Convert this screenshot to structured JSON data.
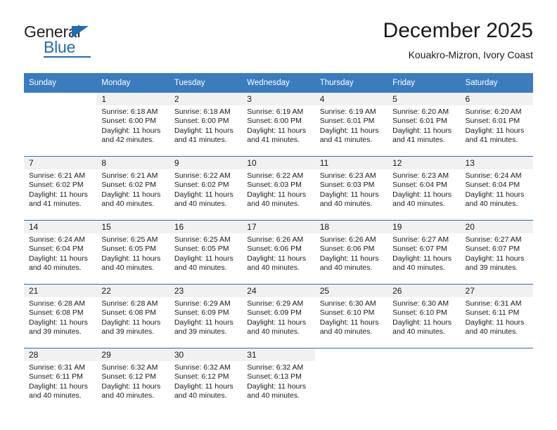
{
  "logo": {
    "word_top": "General",
    "word_bottom": "Blue",
    "triangle_color": "#1f6cb0"
  },
  "header": {
    "title": "December 2025",
    "subtitle": "Kouakro-Mizron, Ivory Coast"
  },
  "theme": {
    "header_row_bg": "#3a7cbe",
    "day_band_bg": "#f1f1f1",
    "row_divider": "#2f6fa8",
    "text": "#1a1a1a"
  },
  "weekday_headers": [
    "Sunday",
    "Monday",
    "Tuesday",
    "Wednesday",
    "Thursday",
    "Friday",
    "Saturday"
  ],
  "weeks": [
    [
      {
        "day": "",
        "lines": []
      },
      {
        "day": "1",
        "lines": [
          "Sunrise: 6:18 AM",
          "Sunset: 6:00 PM",
          "Daylight: 11 hours",
          "and 42 minutes."
        ]
      },
      {
        "day": "2",
        "lines": [
          "Sunrise: 6:18 AM",
          "Sunset: 6:00 PM",
          "Daylight: 11 hours",
          "and 41 minutes."
        ]
      },
      {
        "day": "3",
        "lines": [
          "Sunrise: 6:19 AM",
          "Sunset: 6:00 PM",
          "Daylight: 11 hours",
          "and 41 minutes."
        ]
      },
      {
        "day": "4",
        "lines": [
          "Sunrise: 6:19 AM",
          "Sunset: 6:01 PM",
          "Daylight: 11 hours",
          "and 41 minutes."
        ]
      },
      {
        "day": "5",
        "lines": [
          "Sunrise: 6:20 AM",
          "Sunset: 6:01 PM",
          "Daylight: 11 hours",
          "and 41 minutes."
        ]
      },
      {
        "day": "6",
        "lines": [
          "Sunrise: 6:20 AM",
          "Sunset: 6:01 PM",
          "Daylight: 11 hours",
          "and 41 minutes."
        ]
      }
    ],
    [
      {
        "day": "7",
        "lines": [
          "Sunrise: 6:21 AM",
          "Sunset: 6:02 PM",
          "Daylight: 11 hours",
          "and 41 minutes."
        ]
      },
      {
        "day": "8",
        "lines": [
          "Sunrise: 6:21 AM",
          "Sunset: 6:02 PM",
          "Daylight: 11 hours",
          "and 40 minutes."
        ]
      },
      {
        "day": "9",
        "lines": [
          "Sunrise: 6:22 AM",
          "Sunset: 6:02 PM",
          "Daylight: 11 hours",
          "and 40 minutes."
        ]
      },
      {
        "day": "10",
        "lines": [
          "Sunrise: 6:22 AM",
          "Sunset: 6:03 PM",
          "Daylight: 11 hours",
          "and 40 minutes."
        ]
      },
      {
        "day": "11",
        "lines": [
          "Sunrise: 6:23 AM",
          "Sunset: 6:03 PM",
          "Daylight: 11 hours",
          "and 40 minutes."
        ]
      },
      {
        "day": "12",
        "lines": [
          "Sunrise: 6:23 AM",
          "Sunset: 6:04 PM",
          "Daylight: 11 hours",
          "and 40 minutes."
        ]
      },
      {
        "day": "13",
        "lines": [
          "Sunrise: 6:24 AM",
          "Sunset: 6:04 PM",
          "Daylight: 11 hours",
          "and 40 minutes."
        ]
      }
    ],
    [
      {
        "day": "14",
        "lines": [
          "Sunrise: 6:24 AM",
          "Sunset: 6:04 PM",
          "Daylight: 11 hours",
          "and 40 minutes."
        ]
      },
      {
        "day": "15",
        "lines": [
          "Sunrise: 6:25 AM",
          "Sunset: 6:05 PM",
          "Daylight: 11 hours",
          "and 40 minutes."
        ]
      },
      {
        "day": "16",
        "lines": [
          "Sunrise: 6:25 AM",
          "Sunset: 6:05 PM",
          "Daylight: 11 hours",
          "and 40 minutes."
        ]
      },
      {
        "day": "17",
        "lines": [
          "Sunrise: 6:26 AM",
          "Sunset: 6:06 PM",
          "Daylight: 11 hours",
          "and 40 minutes."
        ]
      },
      {
        "day": "18",
        "lines": [
          "Sunrise: 6:26 AM",
          "Sunset: 6:06 PM",
          "Daylight: 11 hours",
          "and 40 minutes."
        ]
      },
      {
        "day": "19",
        "lines": [
          "Sunrise: 6:27 AM",
          "Sunset: 6:07 PM",
          "Daylight: 11 hours",
          "and 40 minutes."
        ]
      },
      {
        "day": "20",
        "lines": [
          "Sunrise: 6:27 AM",
          "Sunset: 6:07 PM",
          "Daylight: 11 hours",
          "and 39 minutes."
        ]
      }
    ],
    [
      {
        "day": "21",
        "lines": [
          "Sunrise: 6:28 AM",
          "Sunset: 6:08 PM",
          "Daylight: 11 hours",
          "and 39 minutes."
        ]
      },
      {
        "day": "22",
        "lines": [
          "Sunrise: 6:28 AM",
          "Sunset: 6:08 PM",
          "Daylight: 11 hours",
          "and 39 minutes."
        ]
      },
      {
        "day": "23",
        "lines": [
          "Sunrise: 6:29 AM",
          "Sunset: 6:09 PM",
          "Daylight: 11 hours",
          "and 39 minutes."
        ]
      },
      {
        "day": "24",
        "lines": [
          "Sunrise: 6:29 AM",
          "Sunset: 6:09 PM",
          "Daylight: 11 hours",
          "and 40 minutes."
        ]
      },
      {
        "day": "25",
        "lines": [
          "Sunrise: 6:30 AM",
          "Sunset: 6:10 PM",
          "Daylight: 11 hours",
          "and 40 minutes."
        ]
      },
      {
        "day": "26",
        "lines": [
          "Sunrise: 6:30 AM",
          "Sunset: 6:10 PM",
          "Daylight: 11 hours",
          "and 40 minutes."
        ]
      },
      {
        "day": "27",
        "lines": [
          "Sunrise: 6:31 AM",
          "Sunset: 6:11 PM",
          "Daylight: 11 hours",
          "and 40 minutes."
        ]
      }
    ],
    [
      {
        "day": "28",
        "lines": [
          "Sunrise: 6:31 AM",
          "Sunset: 6:11 PM",
          "Daylight: 11 hours",
          "and 40 minutes."
        ]
      },
      {
        "day": "29",
        "lines": [
          "Sunrise: 6:32 AM",
          "Sunset: 6:12 PM",
          "Daylight: 11 hours",
          "and 40 minutes."
        ]
      },
      {
        "day": "30",
        "lines": [
          "Sunrise: 6:32 AM",
          "Sunset: 6:12 PM",
          "Daylight: 11 hours",
          "and 40 minutes."
        ]
      },
      {
        "day": "31",
        "lines": [
          "Sunrise: 6:32 AM",
          "Sunset: 6:13 PM",
          "Daylight: 11 hours",
          "and 40 minutes."
        ]
      },
      {
        "day": "",
        "lines": []
      },
      {
        "day": "",
        "lines": []
      },
      {
        "day": "",
        "lines": []
      }
    ]
  ]
}
